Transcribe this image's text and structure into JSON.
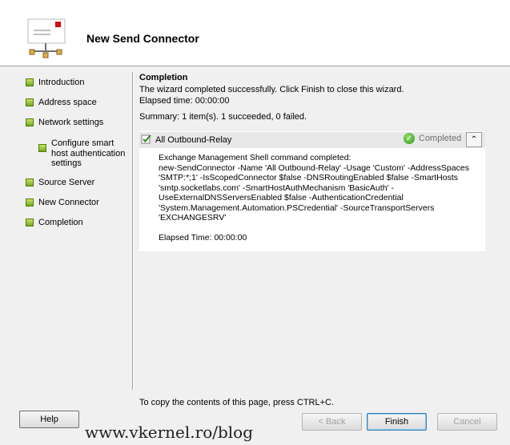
{
  "window": {
    "title": "New Send Connector"
  },
  "nav": {
    "items": [
      {
        "label": "Introduction"
      },
      {
        "label": "Address space"
      },
      {
        "label": "Network settings"
      },
      {
        "label": "Configure smart host authentication settings"
      },
      {
        "label": "Source Server"
      },
      {
        "label": "New Connector"
      },
      {
        "label": "Completion"
      }
    ]
  },
  "completion": {
    "title": "Completion",
    "message": "The wizard completed successfully. Click Finish to close this wizard.",
    "elapsed": "Elapsed time: 00:00:00",
    "summary": "Summary: 1 item(s). 1 succeeded, 0 failed."
  },
  "task": {
    "name": "All Outbound-Relay",
    "status": "Completed",
    "command_heading": "Exchange Management Shell command completed:",
    "command": "new-SendConnector -Name 'All Outbound-Relay' -Usage 'Custom' -AddressSpaces 'SMTP:*;1' -IsScopedConnector $false -DNSRoutingEnabled $false -SmartHosts 'smtp.socketlabs.com' -SmartHostAuthMechanism 'BasicAuth' -UseExternalDNSServersEnabled $false -AuthenticationCredential 'System.Management.Automation.PSCredential' -SourceTransportServers 'EXCHANGESRV'",
    "elapsed": "Elapsed Time: 00:00:00"
  },
  "footer": {
    "copy_hint": "To copy the contents of this page, press CTRL+C.",
    "help": "Help",
    "back": "< Back",
    "finish": "Finish",
    "cancel": "Cancel"
  },
  "watermark": "www.vkernel.ro/blog",
  "colors": {
    "bullet": "#8cc63f",
    "status_ok": "#3aa52a"
  },
  "icons": {
    "logo": "send-connector-icon",
    "task": "task-icon",
    "status": "check-circle-icon",
    "collapse": "chevron-up-icon"
  }
}
